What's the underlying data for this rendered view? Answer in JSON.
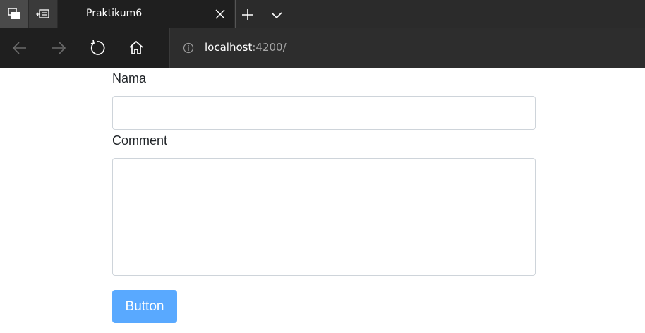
{
  "browser": {
    "tab": {
      "title": "Praktikum6"
    },
    "address": {
      "host": "localhost",
      "port_path": ":4200/"
    }
  },
  "form": {
    "name_label": "Nama",
    "name_value": "",
    "comment_label": "Comment",
    "comment_value": "",
    "button_label": "Button"
  },
  "colors": {
    "chrome_dark": "#1f1f1f",
    "tabstrip": "#2b2b2b",
    "address_bg": "#2d2d2d",
    "button_bg": "#59a9ff",
    "input_border": "#ced4da"
  },
  "icons": {
    "set_aside_tabs": "tabs-aside-icon",
    "show_set_aside": "tabs-restore-icon",
    "close": "close-icon",
    "new_tab": "plus-icon",
    "tab_menu": "chevron-down-icon",
    "back": "arrow-left-icon",
    "forward": "arrow-right-icon",
    "refresh": "refresh-icon",
    "home": "home-icon",
    "site_info": "info-icon"
  }
}
